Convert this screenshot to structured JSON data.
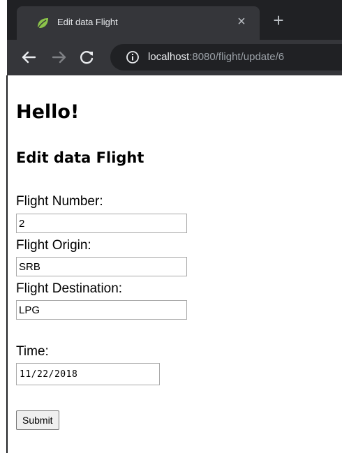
{
  "browser": {
    "tab": {
      "title": "Edit data Flight",
      "close_glyph": "×",
      "favicon": "spring-leaf-icon"
    },
    "new_tab_glyph": "+",
    "address": {
      "host": "localhost",
      "path": ":8080/flight/update/6"
    },
    "colors": {
      "chrome_dark": "#202124",
      "chrome_active": "#35363a",
      "favicon_green": "#8bc34a"
    }
  },
  "page": {
    "heading": "Hello!",
    "form_title": "Edit data Flight",
    "fields": {
      "flight_number": {
        "label": "Flight Number:",
        "value": "2"
      },
      "flight_origin": {
        "label": "Flight Origin:",
        "value": "SRB"
      },
      "flight_destination": {
        "label": "Flight Destination:",
        "value": "LPG"
      },
      "time": {
        "label": "Time:",
        "value": "11/22/2018"
      }
    },
    "submit_label": "Submit"
  }
}
